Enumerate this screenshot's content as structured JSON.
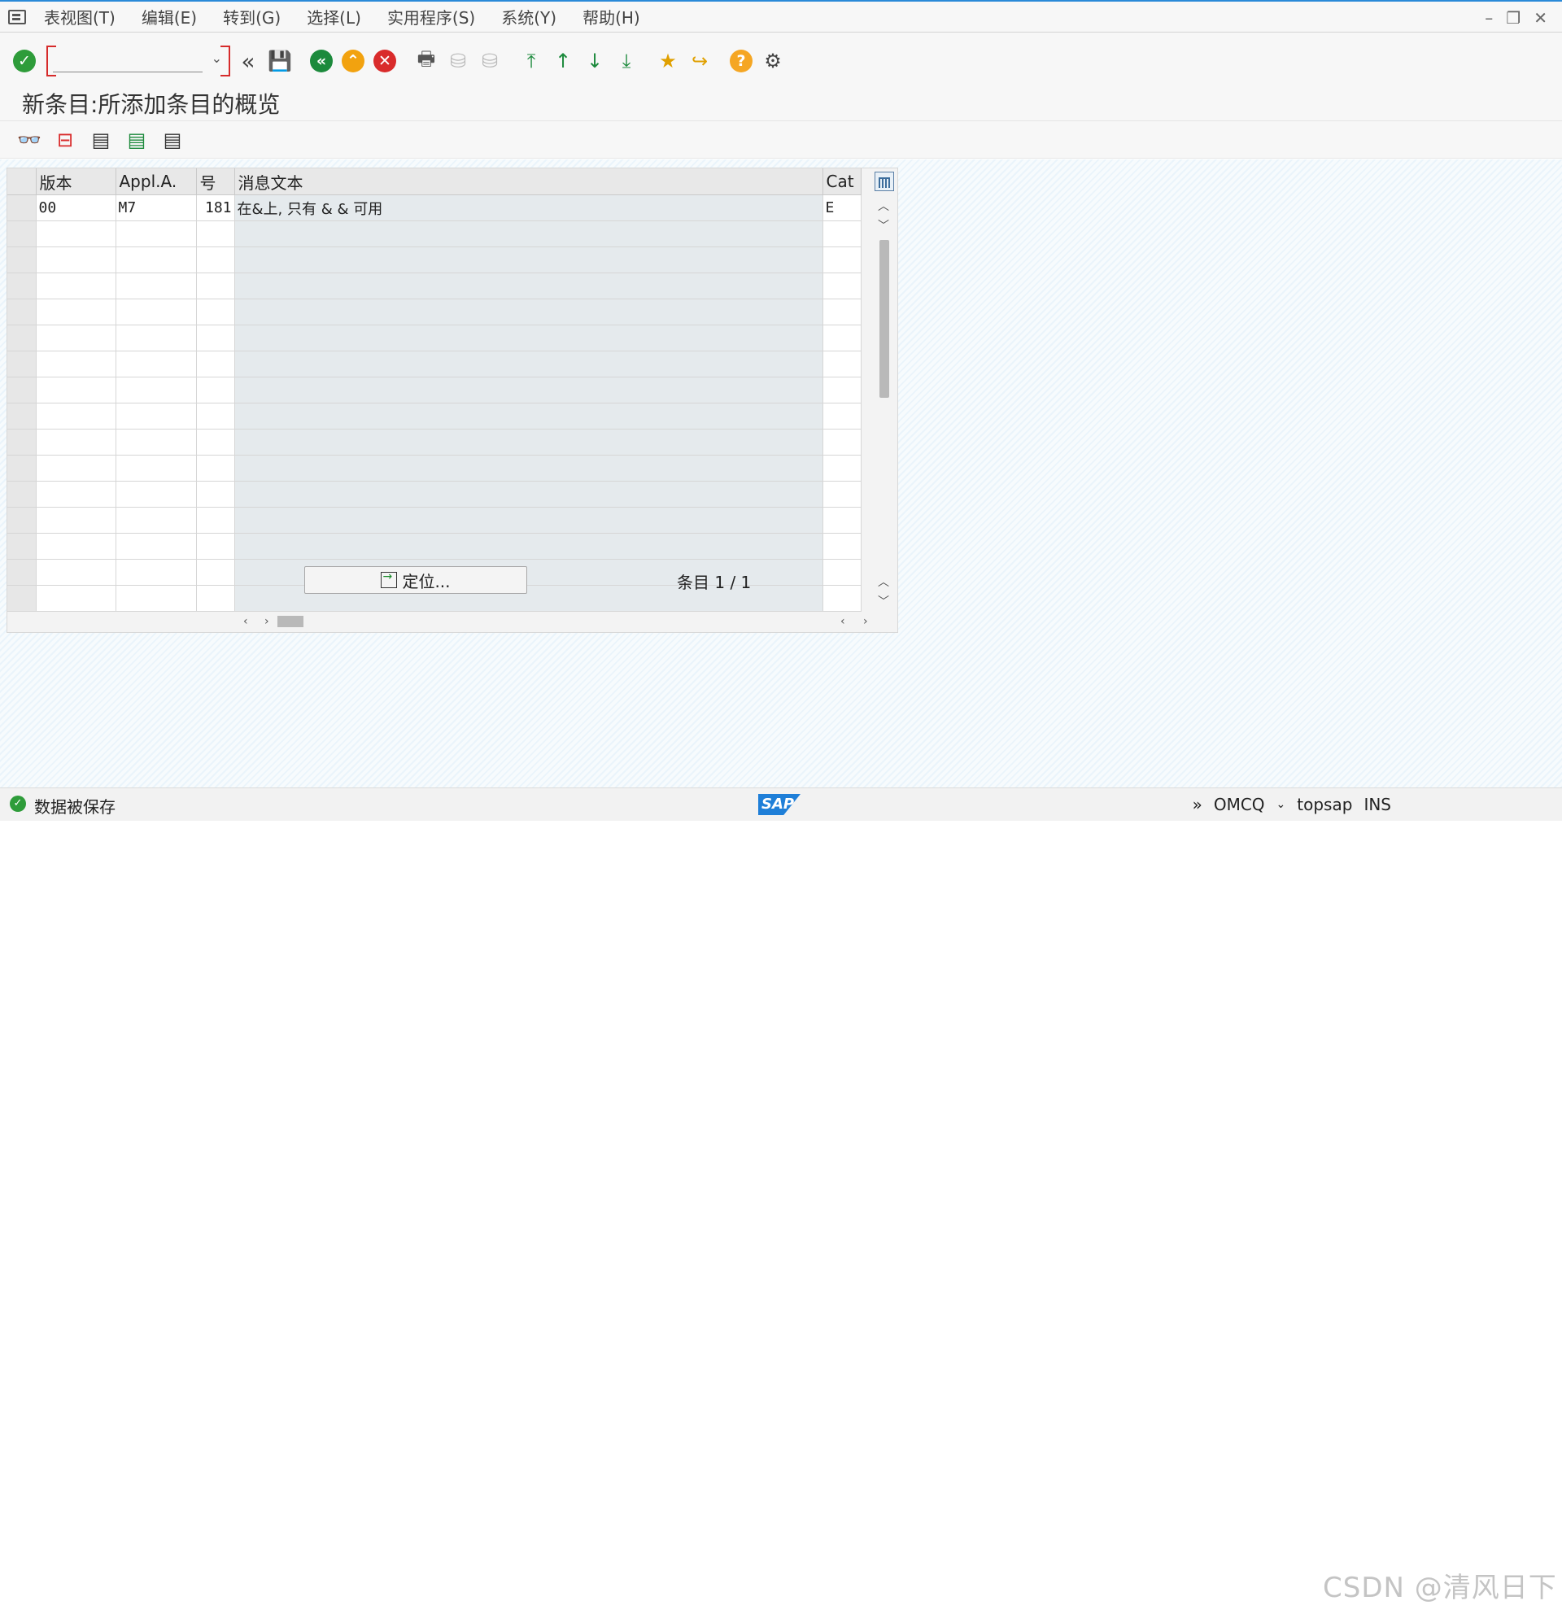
{
  "menubar": {
    "items": [
      "表视图(T)",
      "编辑(E)",
      "转到(G)",
      "选择(L)",
      "实用程序(S)",
      "系统(Y)",
      "帮助(H)"
    ]
  },
  "toolbar": {
    "command_value": ""
  },
  "page": {
    "title": "新条目:所添加条目的概览"
  },
  "table": {
    "headers": [
      "版本",
      "Appl.A.",
      "号",
      "消息文本",
      "Cat"
    ],
    "row": {
      "version": "00",
      "appl": "M7",
      "number": "181",
      "message": "在&上, 只有 & & 可用",
      "cat": "E"
    }
  },
  "footer": {
    "position_button": "定位...",
    "entry_label": "条目",
    "entry_value": "1 / 1"
  },
  "status": {
    "message": "数据被保存",
    "transaction": "OMCQ",
    "server": "topsap",
    "mode": "INS"
  },
  "watermark": "CSDN @清风日下",
  "colors": {
    "accent": "#2a8ad8",
    "ok_green": "#2e9c3a",
    "back_green": "#1c8a3c",
    "exit_orange": "#f2a20f",
    "cancel_red": "#d92b2b",
    "help_orange": "#f5a623"
  }
}
